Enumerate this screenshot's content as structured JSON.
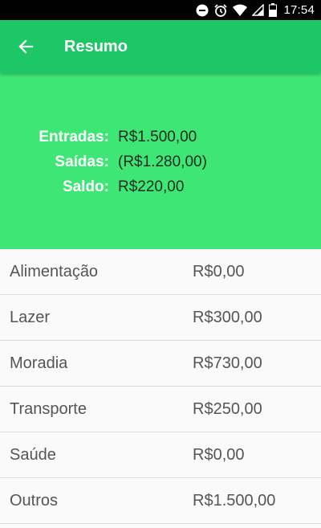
{
  "status_bar": {
    "time": "17:54",
    "icons": [
      "do-not-disturb-icon",
      "alarm-icon",
      "wifi-icon",
      "signal-icon",
      "battery-icon"
    ]
  },
  "toolbar": {
    "title": "Resumo",
    "back_icon": "arrow-back-icon"
  },
  "summary": {
    "rows": [
      {
        "label": "Entradas:",
        "value": "R$1.500,00"
      },
      {
        "label": "Saídas:",
        "value": "(R$1.280,00)"
      },
      {
        "label": "Saldo:",
        "value": "R$220,00"
      }
    ]
  },
  "categories": [
    {
      "name": "Alimentação",
      "value": "R$0,00"
    },
    {
      "name": "Lazer",
      "value": "R$300,00"
    },
    {
      "name": "Moradia",
      "value": "R$730,00"
    },
    {
      "name": "Transporte",
      "value": "R$250,00"
    },
    {
      "name": "Saúde",
      "value": "R$0,00"
    },
    {
      "name": "Outros",
      "value": "R$1.500,00"
    }
  ],
  "colors": {
    "toolbar": "#1ec766",
    "summary_background": "#3ee675",
    "summary_label": "#ffffff",
    "summary_value": "#1f2b22",
    "list_text": "#555555",
    "divider": "#dcdcdc"
  }
}
